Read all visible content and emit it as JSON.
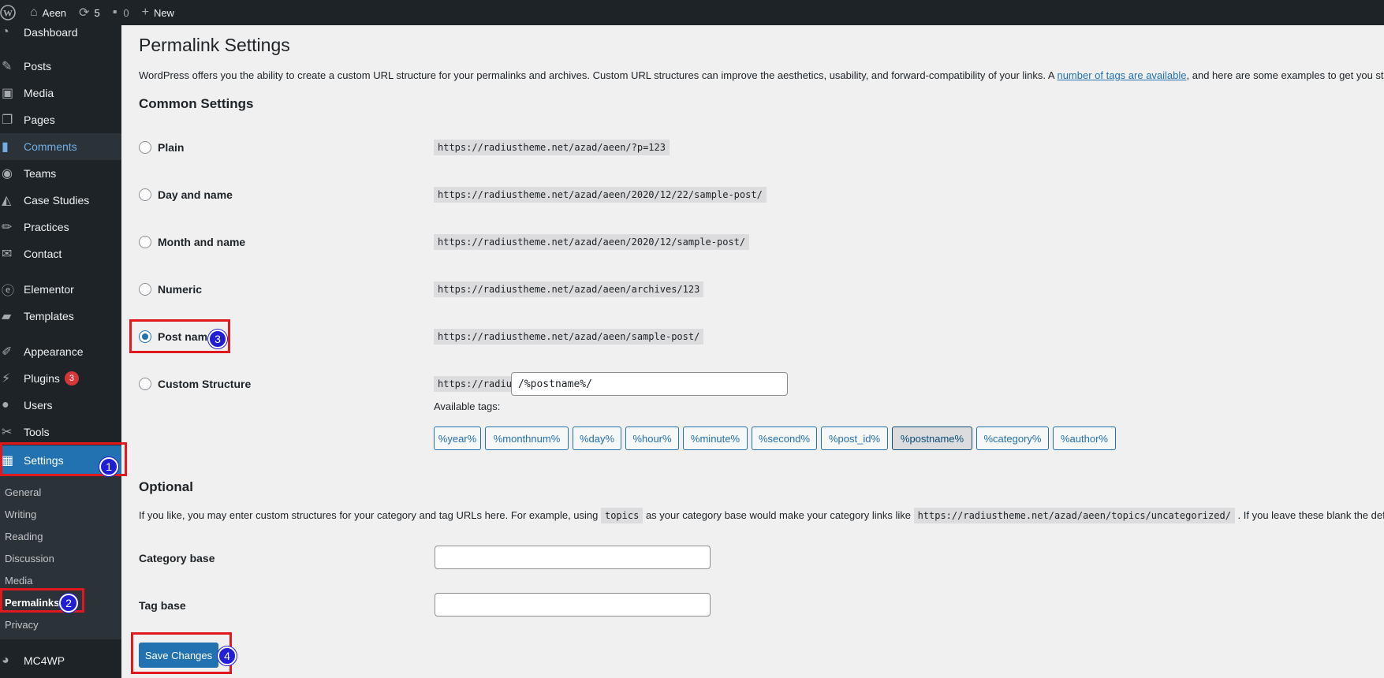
{
  "adminbar": {
    "site_name": "Aeen",
    "updates_count": "5",
    "comments_count": "0",
    "new_label": "New"
  },
  "sidebar": {
    "items": [
      {
        "label": "Dashboard",
        "icon": "dashboard-icon"
      },
      {
        "label": "Posts",
        "icon": "pin-icon"
      },
      {
        "label": "Media",
        "icon": "media-icon"
      },
      {
        "label": "Pages",
        "icon": "pages-icon"
      },
      {
        "label": "Comments",
        "icon": "comment-icon"
      },
      {
        "label": "Teams",
        "icon": "team-icon"
      },
      {
        "label": "Case Studies",
        "icon": "graduation-cap-icon"
      },
      {
        "label": "Practices",
        "icon": "pencil-icon"
      },
      {
        "label": "Contact",
        "icon": "mail-icon"
      },
      {
        "label": "Elementor",
        "icon": "elementor-icon"
      },
      {
        "label": "Templates",
        "icon": "folder-icon"
      },
      {
        "label": "Appearance",
        "icon": "brush-icon"
      },
      {
        "label": "Plugins",
        "icon": "plugin-icon",
        "badge": "3"
      },
      {
        "label": "Users",
        "icon": "user-icon"
      },
      {
        "label": "Tools",
        "icon": "wrench-icon"
      },
      {
        "label": "Settings",
        "icon": "settings-icon"
      },
      {
        "label": "MC4WP",
        "icon": "mc4wp-icon"
      }
    ],
    "submenu": [
      "General",
      "Writing",
      "Reading",
      "Discussion",
      "Media",
      "Permalinks",
      "Privacy"
    ]
  },
  "page": {
    "title": "Permalink Settings",
    "intro_before": "WordPress offers you the ability to create a custom URL structure for your permalinks and archives. Custom URL structures can improve the aesthetics, usability, and forward-compatibility of your links. A ",
    "intro_link": "number of tags are available",
    "intro_after": ", and here are some examples to get you star",
    "common_heading": "Common Settings",
    "options": [
      {
        "label": "Plain",
        "url": "https://radiustheme.net/azad/aeen/?p=123"
      },
      {
        "label": "Day and name",
        "url": "https://radiustheme.net/azad/aeen/2020/12/22/sample-post/"
      },
      {
        "label": "Month and name",
        "url": "https://radiustheme.net/azad/aeen/2020/12/sample-post/"
      },
      {
        "label": "Numeric",
        "url": "https://radiustheme.net/azad/aeen/archives/123"
      },
      {
        "label": "Post name",
        "url": "https://radiustheme.net/azad/aeen/sample-post/",
        "selected": true
      },
      {
        "label": "Custom Structure",
        "url": "https://radiustheme.net/azad/aeen",
        "value": "/%postname%/"
      }
    ],
    "available_tags_label": "Available tags:",
    "tags": [
      "%year%",
      "%monthnum%",
      "%day%",
      "%hour%",
      "%minute%",
      "%second%",
      "%post_id%",
      "%postname%",
      "%category%",
      "%author%"
    ],
    "active_tag": "%postname%",
    "optional_heading": "Optional",
    "optional_text_1": "If you like, you may enter custom structures for your category and tag URLs here. For example, using ",
    "optional_code_1": "topics",
    "optional_text_2": " as your category base would make your category links like ",
    "optional_code_2": "https://radiustheme.net/azad/aeen/topics/uncategorized/",
    "optional_text_3": " . If you leave these blank the defau",
    "category_base_label": "Category base",
    "category_base_value": "",
    "tag_base_label": "Tag base",
    "tag_base_value": "",
    "save_label": "Save Changes"
  },
  "annotations": [
    "1",
    "2",
    "3",
    "4"
  ],
  "colors": {
    "admin_dark": "#1d2327",
    "accent_blue": "#2271b1",
    "highlight_red": "#e0191f",
    "step_blue": "#1f1fd6"
  }
}
